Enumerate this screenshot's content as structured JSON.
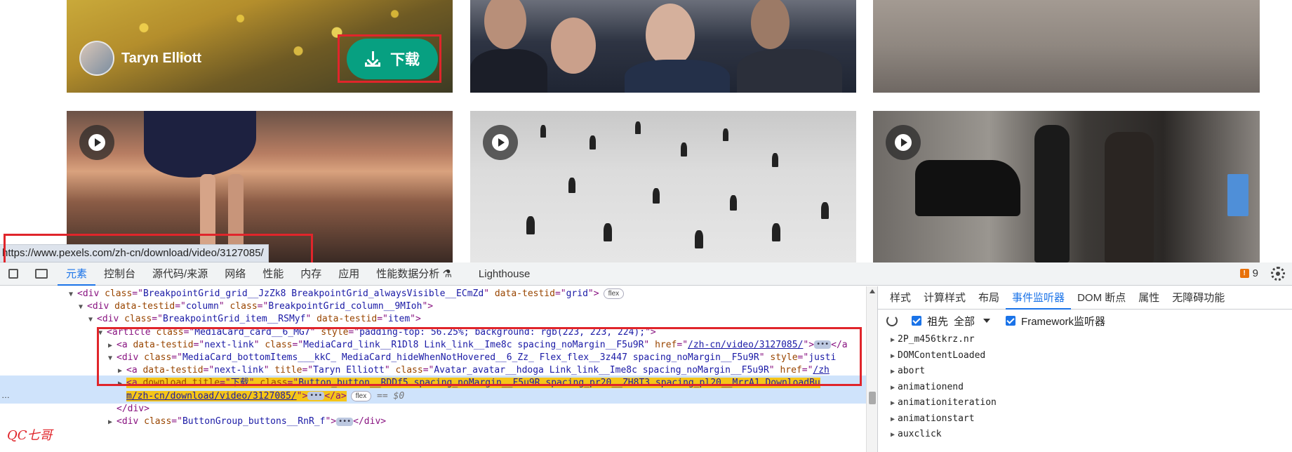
{
  "page": {
    "author_name": "Taryn Elliott",
    "download_label": "下载",
    "status_url": "https://www.pexels.com/zh-cn/download/video/3127085/"
  },
  "devtools": {
    "tabs": [
      "元素",
      "控制台",
      "源代码/来源",
      "网络",
      "性能",
      "内存",
      "应用",
      "性能数据分析",
      "Lighthouse"
    ],
    "active_tab": "元素",
    "issues_count": "9",
    "side_tabs": [
      "样式",
      "计算样式",
      "布局",
      "事件监听器",
      "DOM 断点",
      "属性",
      "无障碍功能"
    ],
    "active_side_tab": "事件监听器",
    "ancestors_label": "祖先",
    "filter_value": "全部",
    "framework_label": "Framework监听器",
    "events": [
      "2P_m456tkrz.nr",
      "DOMContentLoaded",
      "abort",
      "animationend",
      "animationiteration",
      "animationstart",
      "auxclick"
    ],
    "dom_lines": [
      {
        "indent": 1,
        "tri": "▼",
        "parts": [
          [
            "tag",
            "<div "
          ],
          [
            "attr",
            "class"
          ],
          [
            "tag",
            "=\""
          ],
          [
            "val",
            "BreakpointGrid_grid__JzZk8 BreakpointGrid_alwaysVisible__ECmZd"
          ],
          [
            "tag",
            "\" "
          ],
          [
            "attr",
            "data-testid"
          ],
          [
            "tag",
            "=\""
          ],
          [
            "val",
            "grid"
          ],
          [
            "tag",
            "\">"
          ]
        ],
        "pill": "flex"
      },
      {
        "indent": 2,
        "tri": "▼",
        "parts": [
          [
            "tag",
            "<div "
          ],
          [
            "attr",
            "data-testid"
          ],
          [
            "tag",
            "=\""
          ],
          [
            "val",
            "column"
          ],
          [
            "tag",
            "\" "
          ],
          [
            "attr",
            "class"
          ],
          [
            "tag",
            "=\""
          ],
          [
            "val",
            "BreakpointGrid_column__9MIoh"
          ],
          [
            "tag",
            "\">"
          ]
        ]
      },
      {
        "indent": 3,
        "tri": "▼",
        "parts": [
          [
            "tag",
            "<div "
          ],
          [
            "attr",
            "class"
          ],
          [
            "tag",
            "=\""
          ],
          [
            "val",
            "BreakpointGrid_item__RSMyf"
          ],
          [
            "tag",
            "\" "
          ],
          [
            "attr",
            "data-testid"
          ],
          [
            "tag",
            "=\""
          ],
          [
            "val",
            "item"
          ],
          [
            "tag",
            "\">"
          ]
        ]
      },
      {
        "indent": 4,
        "tri": "▼",
        "parts": [
          [
            "tag",
            "<article "
          ],
          [
            "attr",
            "class"
          ],
          [
            "tag",
            "=\""
          ],
          [
            "val",
            "MediaCard_card__6_MG7"
          ],
          [
            "tag",
            "\" "
          ],
          [
            "attr",
            "style"
          ],
          [
            "tag",
            "=\""
          ],
          [
            "val",
            "padding-top: 56.25%; background: rgb(223, 223, 224);"
          ],
          [
            "tag",
            "\">"
          ]
        ]
      },
      {
        "indent": 5,
        "tri": "▶",
        "parts": [
          [
            "tag",
            "<a "
          ],
          [
            "attr",
            "data-testid"
          ],
          [
            "tag",
            "=\""
          ],
          [
            "val",
            "next-link"
          ],
          [
            "tag",
            "\" "
          ],
          [
            "attr",
            "class"
          ],
          [
            "tag",
            "=\""
          ],
          [
            "val",
            "MediaCard_link__R1Dl8 Link_link__Ime8c spacing_noMargin__F5u9R"
          ],
          [
            "tag",
            "\" "
          ],
          [
            "attr",
            "href"
          ],
          [
            "tag",
            "=\""
          ],
          [
            "link",
            "/zh-cn/video/3127085/"
          ],
          [
            "tag",
            "\">"
          ]
        ],
        "dots": true,
        "tail": "</a"
      },
      {
        "indent": 5,
        "tri": "▼",
        "parts": [
          [
            "tag",
            "<div "
          ],
          [
            "attr",
            "class"
          ],
          [
            "tag",
            "=\""
          ],
          [
            "val",
            "MediaCard_bottomItems___kkC_ MediaCard_hideWhenNotHovered__6_Zz_ Flex_flex__3z447 spacing_noMargin__F5u9R"
          ],
          [
            "tag",
            "\" "
          ],
          [
            "attr",
            "style"
          ],
          [
            "tag",
            "=\""
          ],
          [
            "val",
            "justi"
          ]
        ]
      },
      {
        "indent": 6,
        "tri": "▶",
        "parts": [
          [
            "tag",
            "<a "
          ],
          [
            "attr",
            "data-testid"
          ],
          [
            "tag",
            "=\""
          ],
          [
            "val",
            "next-link"
          ],
          [
            "tag",
            "\" "
          ],
          [
            "attr",
            "title"
          ],
          [
            "tag",
            "=\""
          ],
          [
            "val",
            "Taryn Elliott"
          ],
          [
            "tag",
            "\" "
          ],
          [
            "attr",
            "class"
          ],
          [
            "tag",
            "=\""
          ],
          [
            "val",
            "Avatar_avatar__hdoga Link_link__Ime8c spacing_noMargin__F5u9R"
          ],
          [
            "tag",
            "\" "
          ],
          [
            "attr",
            "href"
          ],
          [
            "tag",
            "=\""
          ],
          [
            "link",
            "/zh"
          ]
        ]
      },
      {
        "indent": 6,
        "tri": "▶",
        "sel": true,
        "parts": [
          [
            "tag",
            "<a "
          ],
          [
            "attr",
            "download"
          ],
          [
            "tag",
            " "
          ],
          [
            "attr",
            "title"
          ],
          [
            "tag",
            "=\""
          ],
          [
            "val",
            "下载"
          ],
          [
            "tag",
            "\" "
          ],
          [
            "attr",
            "class"
          ],
          [
            "tag",
            "=\""
          ],
          [
            "val",
            "Button_button__RDDf5 spacing_noMargin__F5u9R  spacing_pr20__ZH8T3  spacing_pl20__MrrA1 DownloadBu"
          ]
        ],
        "highlight": true
      },
      {
        "indent": 6,
        "tri": "",
        "sel": true,
        "parts": [
          [
            "link",
            "m/zh-cn/download/video/3127085/"
          ],
          [
            "tag",
            "\">"
          ]
        ],
        "dots": true,
        "tail": "</a>",
        "pill": "flex",
        "eq": "== $0",
        "highlight": true
      },
      {
        "indent": 5,
        "tri": "",
        "parts": [
          [
            "tag",
            "</div>"
          ]
        ]
      },
      {
        "indent": 5,
        "tri": "▶",
        "parts": [
          [
            "tag",
            "<div "
          ],
          [
            "attr",
            "class"
          ],
          [
            "tag",
            "=\""
          ],
          [
            "val",
            "ButtonGroup_buttons__RnR_f"
          ],
          [
            "tag",
            "\">"
          ]
        ],
        "dots": true,
        "tail": "</div>"
      }
    ]
  },
  "watermark": "QC七哥",
  "gutter_dots": "…",
  "colors": {
    "accent": "#1a73e8",
    "download_green": "#07a081",
    "annotation_red": "#e0252b",
    "selection": "#cfe3fb",
    "highlight": "#f5c518"
  },
  "icons": [
    "play-icon",
    "download-icon",
    "inspect-icon",
    "device-toolbar-icon",
    "issues-icon",
    "gear-icon",
    "refresh-icon",
    "caret-down-icon"
  ]
}
